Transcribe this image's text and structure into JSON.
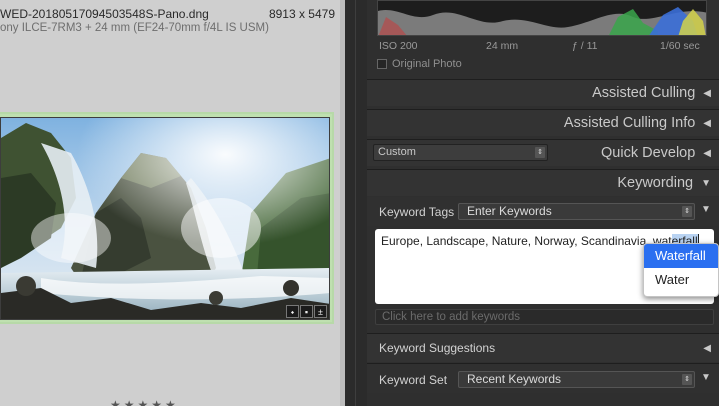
{
  "grid": {
    "filename": "WED-20180517094503548S-Pano.dng",
    "dimensions": "8913 x 5479",
    "camera": "ony ILCE-7RM3 + 24 mm (EF24-70mm f/4L IS USM)",
    "badges": [
      "tag-icon",
      "comment-icon",
      "edit-icon"
    ],
    "rating": "★★★★★"
  },
  "histogram": {
    "iso": "ISO 200",
    "focal": "24 mm",
    "aperture": "ƒ / 11",
    "shutter": "1/60 sec",
    "original_photo_label": "Original Photo"
  },
  "panels": {
    "assisted_culling": "Assisted Culling",
    "assisted_culling_info": "Assisted Culling Info",
    "quick_develop": "Quick Develop",
    "quick_develop_preset": "Custom",
    "keywording": "Keywording",
    "keyword_suggestions": "Keyword Suggestions"
  },
  "keywording": {
    "tags_label": "Keyword Tags",
    "tags_mode": "Enter Keywords",
    "keywords_text": "Europe, Landscape, Nature, Norway, Scandinavia, wat",
    "keywords_highlight": "erfall",
    "add_placeholder": "Click here to add keywords",
    "set_label": "Keyword Set",
    "set_value": "Recent Keywords"
  },
  "autocomplete": {
    "options": [
      "Waterfall",
      "Water"
    ],
    "selected": "Waterfall"
  },
  "colors": {
    "selection": "#2a6ff0",
    "panel_bg": "#2f2f2f",
    "grid_bg": "#cfcfcf",
    "cell_highlight": "#b7d9a8"
  }
}
